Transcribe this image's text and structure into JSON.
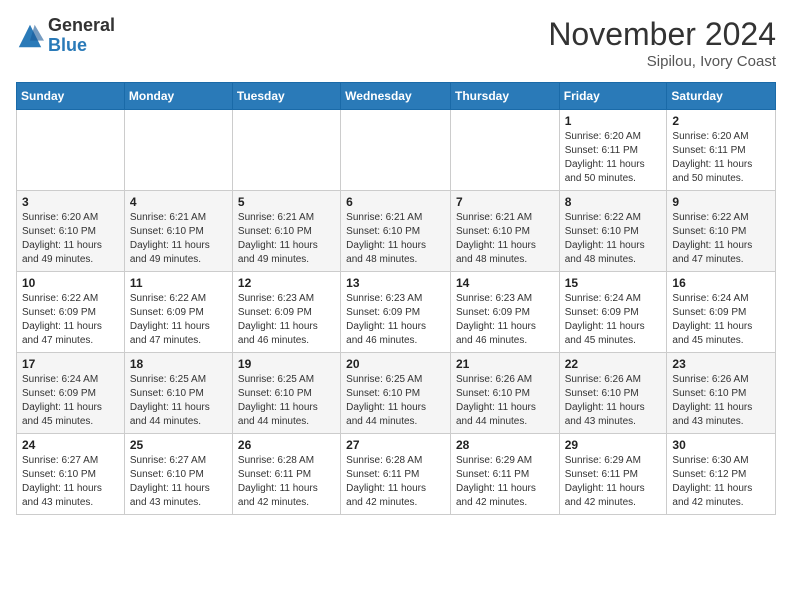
{
  "logo": {
    "general": "General",
    "blue": "Blue"
  },
  "title": "November 2024",
  "location": "Sipilou, Ivory Coast",
  "days_of_week": [
    "Sunday",
    "Monday",
    "Tuesday",
    "Wednesday",
    "Thursday",
    "Friday",
    "Saturday"
  ],
  "weeks": [
    [
      {
        "day": "",
        "info": ""
      },
      {
        "day": "",
        "info": ""
      },
      {
        "day": "",
        "info": ""
      },
      {
        "day": "",
        "info": ""
      },
      {
        "day": "",
        "info": ""
      },
      {
        "day": "1",
        "info": "Sunrise: 6:20 AM\nSunset: 6:11 PM\nDaylight: 11 hours\nand 50 minutes."
      },
      {
        "day": "2",
        "info": "Sunrise: 6:20 AM\nSunset: 6:11 PM\nDaylight: 11 hours\nand 50 minutes."
      }
    ],
    [
      {
        "day": "3",
        "info": "Sunrise: 6:20 AM\nSunset: 6:10 PM\nDaylight: 11 hours\nand 49 minutes."
      },
      {
        "day": "4",
        "info": "Sunrise: 6:21 AM\nSunset: 6:10 PM\nDaylight: 11 hours\nand 49 minutes."
      },
      {
        "day": "5",
        "info": "Sunrise: 6:21 AM\nSunset: 6:10 PM\nDaylight: 11 hours\nand 49 minutes."
      },
      {
        "day": "6",
        "info": "Sunrise: 6:21 AM\nSunset: 6:10 PM\nDaylight: 11 hours\nand 48 minutes."
      },
      {
        "day": "7",
        "info": "Sunrise: 6:21 AM\nSunset: 6:10 PM\nDaylight: 11 hours\nand 48 minutes."
      },
      {
        "day": "8",
        "info": "Sunrise: 6:22 AM\nSunset: 6:10 PM\nDaylight: 11 hours\nand 48 minutes."
      },
      {
        "day": "9",
        "info": "Sunrise: 6:22 AM\nSunset: 6:10 PM\nDaylight: 11 hours\nand 47 minutes."
      }
    ],
    [
      {
        "day": "10",
        "info": "Sunrise: 6:22 AM\nSunset: 6:09 PM\nDaylight: 11 hours\nand 47 minutes."
      },
      {
        "day": "11",
        "info": "Sunrise: 6:22 AM\nSunset: 6:09 PM\nDaylight: 11 hours\nand 47 minutes."
      },
      {
        "day": "12",
        "info": "Sunrise: 6:23 AM\nSunset: 6:09 PM\nDaylight: 11 hours\nand 46 minutes."
      },
      {
        "day": "13",
        "info": "Sunrise: 6:23 AM\nSunset: 6:09 PM\nDaylight: 11 hours\nand 46 minutes."
      },
      {
        "day": "14",
        "info": "Sunrise: 6:23 AM\nSunset: 6:09 PM\nDaylight: 11 hours\nand 46 minutes."
      },
      {
        "day": "15",
        "info": "Sunrise: 6:24 AM\nSunset: 6:09 PM\nDaylight: 11 hours\nand 45 minutes."
      },
      {
        "day": "16",
        "info": "Sunrise: 6:24 AM\nSunset: 6:09 PM\nDaylight: 11 hours\nand 45 minutes."
      }
    ],
    [
      {
        "day": "17",
        "info": "Sunrise: 6:24 AM\nSunset: 6:09 PM\nDaylight: 11 hours\nand 45 minutes."
      },
      {
        "day": "18",
        "info": "Sunrise: 6:25 AM\nSunset: 6:10 PM\nDaylight: 11 hours\nand 44 minutes."
      },
      {
        "day": "19",
        "info": "Sunrise: 6:25 AM\nSunset: 6:10 PM\nDaylight: 11 hours\nand 44 minutes."
      },
      {
        "day": "20",
        "info": "Sunrise: 6:25 AM\nSunset: 6:10 PM\nDaylight: 11 hours\nand 44 minutes."
      },
      {
        "day": "21",
        "info": "Sunrise: 6:26 AM\nSunset: 6:10 PM\nDaylight: 11 hours\nand 44 minutes."
      },
      {
        "day": "22",
        "info": "Sunrise: 6:26 AM\nSunset: 6:10 PM\nDaylight: 11 hours\nand 43 minutes."
      },
      {
        "day": "23",
        "info": "Sunrise: 6:26 AM\nSunset: 6:10 PM\nDaylight: 11 hours\nand 43 minutes."
      }
    ],
    [
      {
        "day": "24",
        "info": "Sunrise: 6:27 AM\nSunset: 6:10 PM\nDaylight: 11 hours\nand 43 minutes."
      },
      {
        "day": "25",
        "info": "Sunrise: 6:27 AM\nSunset: 6:10 PM\nDaylight: 11 hours\nand 43 minutes."
      },
      {
        "day": "26",
        "info": "Sunrise: 6:28 AM\nSunset: 6:11 PM\nDaylight: 11 hours\nand 42 minutes."
      },
      {
        "day": "27",
        "info": "Sunrise: 6:28 AM\nSunset: 6:11 PM\nDaylight: 11 hours\nand 42 minutes."
      },
      {
        "day": "28",
        "info": "Sunrise: 6:29 AM\nSunset: 6:11 PM\nDaylight: 11 hours\nand 42 minutes."
      },
      {
        "day": "29",
        "info": "Sunrise: 6:29 AM\nSunset: 6:11 PM\nDaylight: 11 hours\nand 42 minutes."
      },
      {
        "day": "30",
        "info": "Sunrise: 6:30 AM\nSunset: 6:12 PM\nDaylight: 11 hours\nand 42 minutes."
      }
    ]
  ]
}
